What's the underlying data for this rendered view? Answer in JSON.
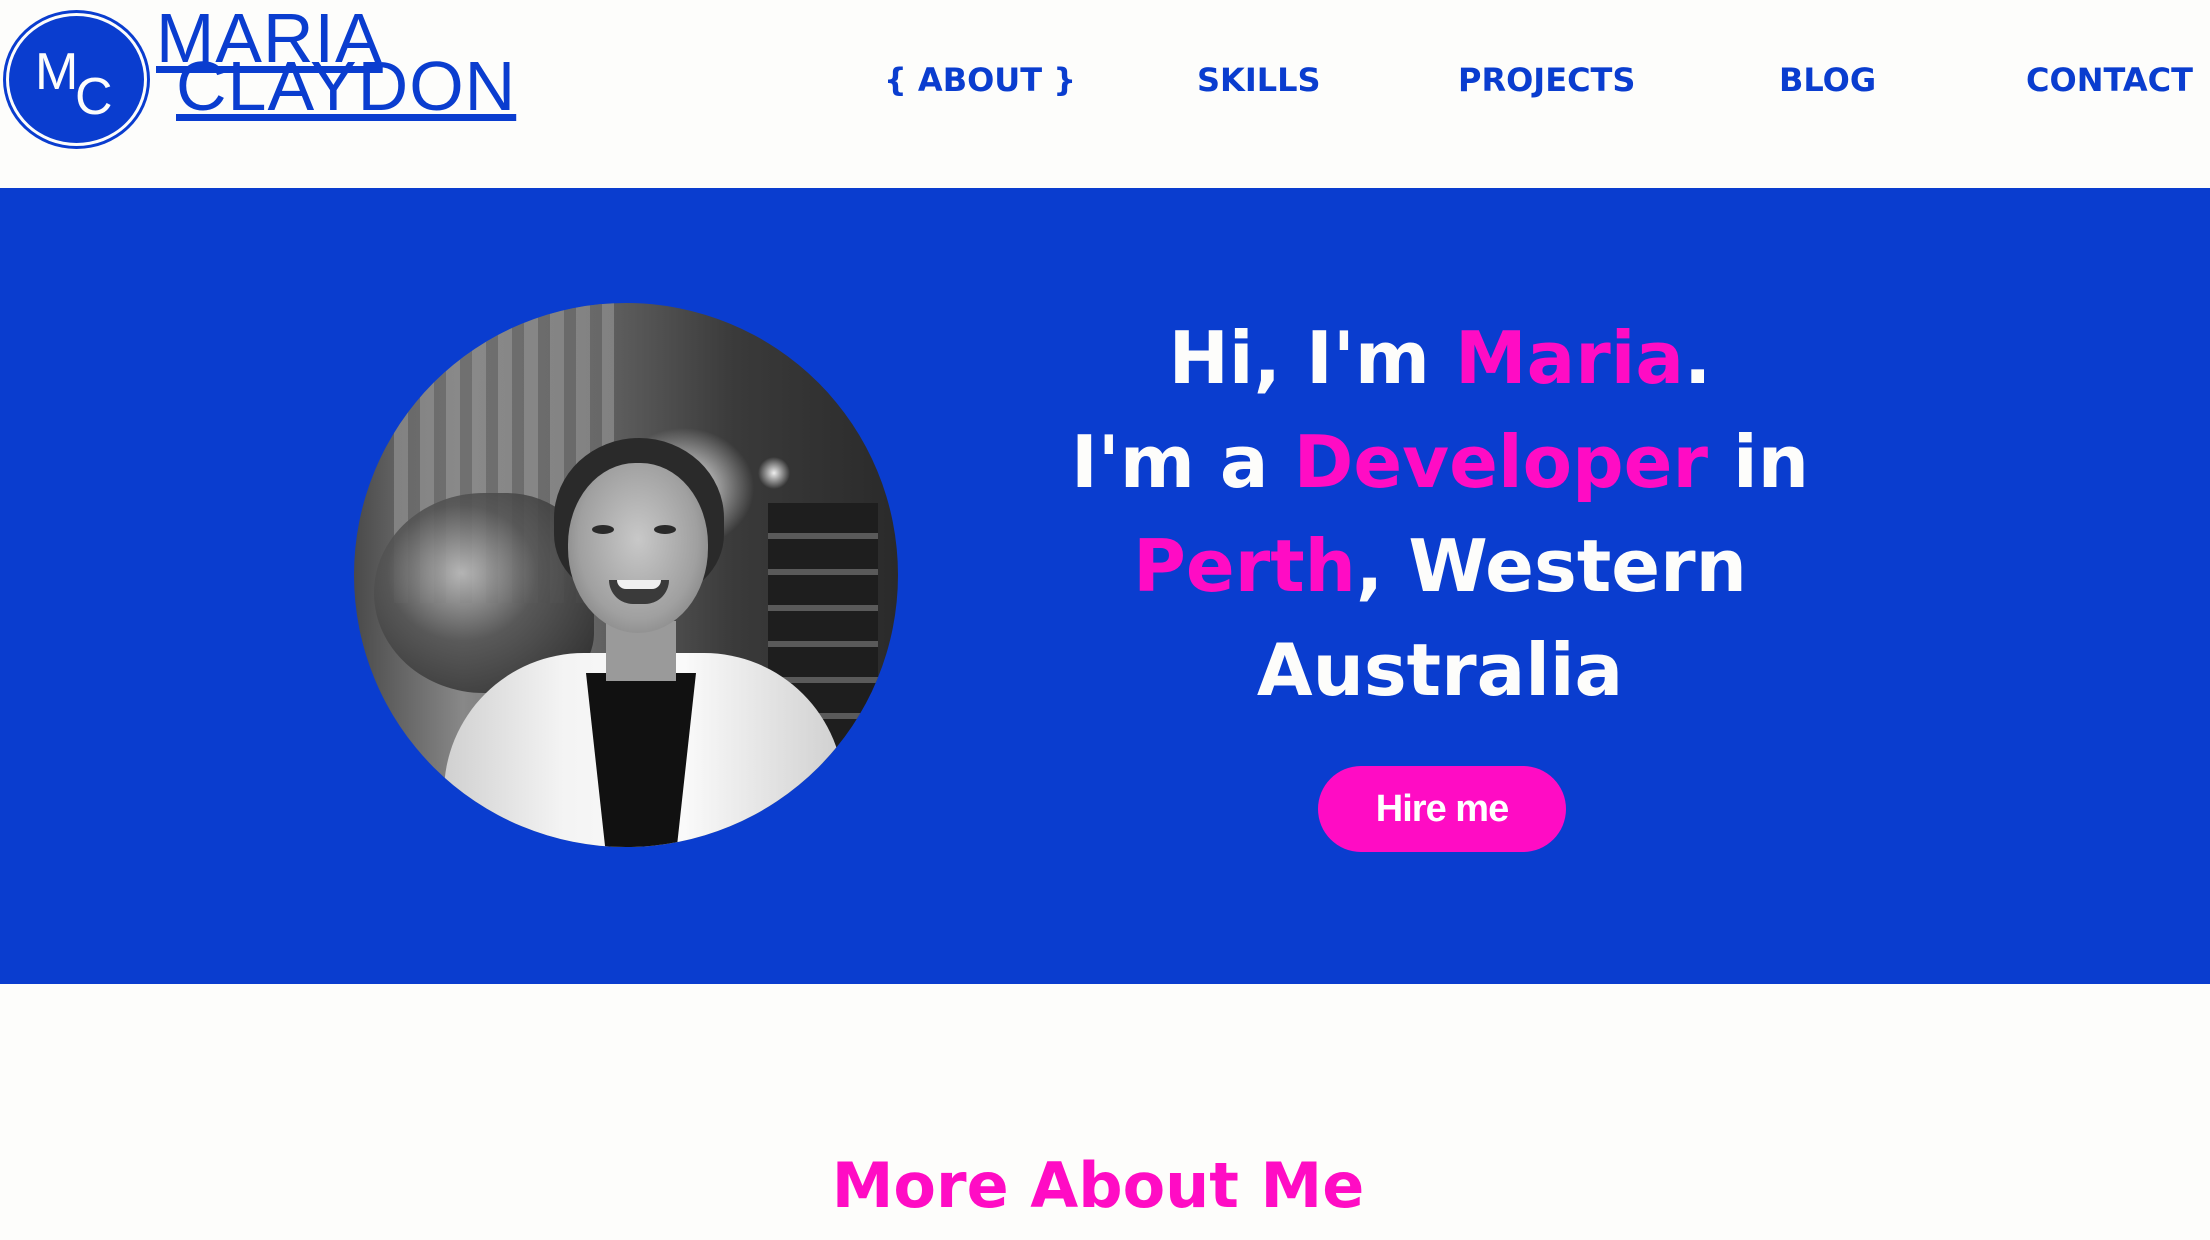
{
  "logo": {
    "monogram_m": "M",
    "monogram_c": "C",
    "name_line1": "MARIA",
    "name_line2": "CLAYDON"
  },
  "nav": {
    "items": [
      {
        "label": "{ ABOUT }",
        "active": true
      },
      {
        "label": "SKILLS"
      },
      {
        "label": "PROJECTS"
      },
      {
        "label": "BLOG"
      },
      {
        "label": "CONTACT"
      }
    ]
  },
  "hero": {
    "greeting_prefix": "Hi, I'm ",
    "name": "Maria",
    "greeting_suffix": ".",
    "role_prefix": "I'm a ",
    "role": "Developer",
    "role_suffix": " in",
    "city": "Perth",
    "city_suffix": ", Western",
    "region": "Australia",
    "cta_label": "Hire me"
  },
  "more": {
    "title": "More About Me"
  },
  "colors": {
    "brand_blue": "#0a3dcf",
    "accent_pink": "#ff0cc4",
    "page_bg": "#fdfdfb"
  },
  "icons": {
    "logo": "monogram-logo-icon",
    "photo": "profile-photo"
  }
}
